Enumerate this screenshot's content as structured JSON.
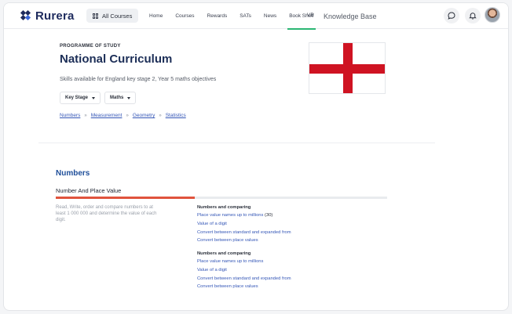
{
  "header": {
    "logo_text": "Rurera",
    "all_courses_label": "All Courses",
    "nav": [
      "Home",
      "Courses",
      "Rewards",
      "SATs",
      "News",
      "Book Shelf"
    ],
    "active_nav_index": 5,
    "nav_suffix": "VB",
    "knowledge_base": "Knowledge Base",
    "icons": [
      "chat-icon",
      "bell-icon",
      "avatar"
    ]
  },
  "hero": {
    "eyebrow": "PROGRAMME OF STUDY",
    "title": "National Curriculum",
    "subtitle": "Skills available for England key stage 2, Year 5 maths objectives",
    "filters": [
      "Key Stage",
      "Maths"
    ],
    "links": [
      "Numbers",
      "Measurement",
      "Geometry",
      "Statistics"
    ],
    "link_separator": "»",
    "flag": "England flag",
    "colors": {
      "flag_red": "#cf1322",
      "title": "#1c2e57"
    }
  },
  "section": {
    "title": "Numbers",
    "topic": "Number And Place Value",
    "progress_fraction": 0.42,
    "description": "Read, Write, order and compare numbers to at least 1 000 000 and determine the value of each digit.",
    "groups": [
      {
        "heading": "Numbers and comparing",
        "items": [
          {
            "label": "Place value names up to millions",
            "count": "(30)"
          },
          {
            "label": "Value of a digit",
            "count": ""
          },
          {
            "label": "Convert between standard and expanded from",
            "count": ""
          },
          {
            "label": "Convert between place values",
            "count": ""
          }
        ]
      },
      {
        "heading": "Numbers and comparing",
        "items": [
          {
            "label": "Place value names up to millions",
            "count": ""
          },
          {
            "label": "Value of a digit",
            "count": ""
          },
          {
            "label": "Convert between standard and expanded from",
            "count": ""
          },
          {
            "label": "Convert between place values",
            "count": ""
          }
        ]
      }
    ],
    "colors": {
      "progress": "#e0533d",
      "section_title": "#1f4f9a",
      "link": "#3557b7"
    }
  }
}
